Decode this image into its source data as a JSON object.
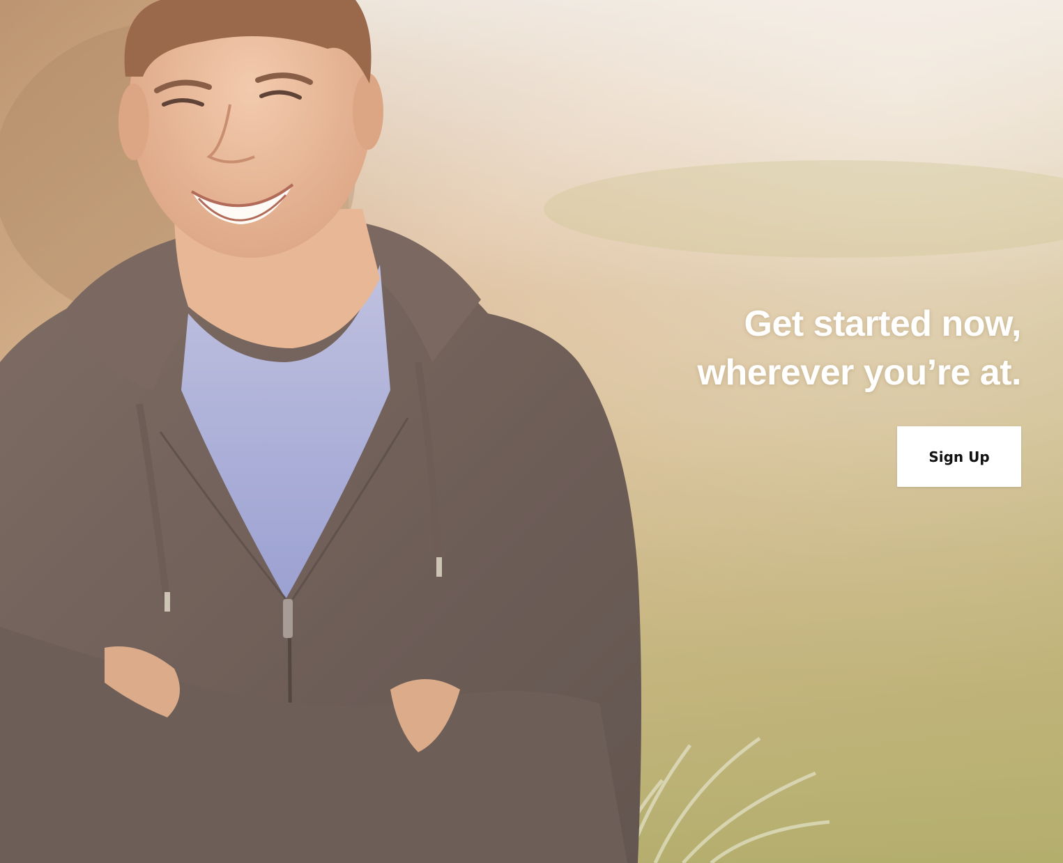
{
  "hero": {
    "headline_line1": "Get started now,",
    "headline_line2": "wherever you’re at.",
    "cta_label": "Sign Up",
    "photo_alt": "Smiling man in gray hoodie with arms crossed in a grassy field"
  },
  "colors": {
    "headline_text": "#ffffff",
    "button_background": "#ffffff",
    "button_text": "#111111"
  }
}
